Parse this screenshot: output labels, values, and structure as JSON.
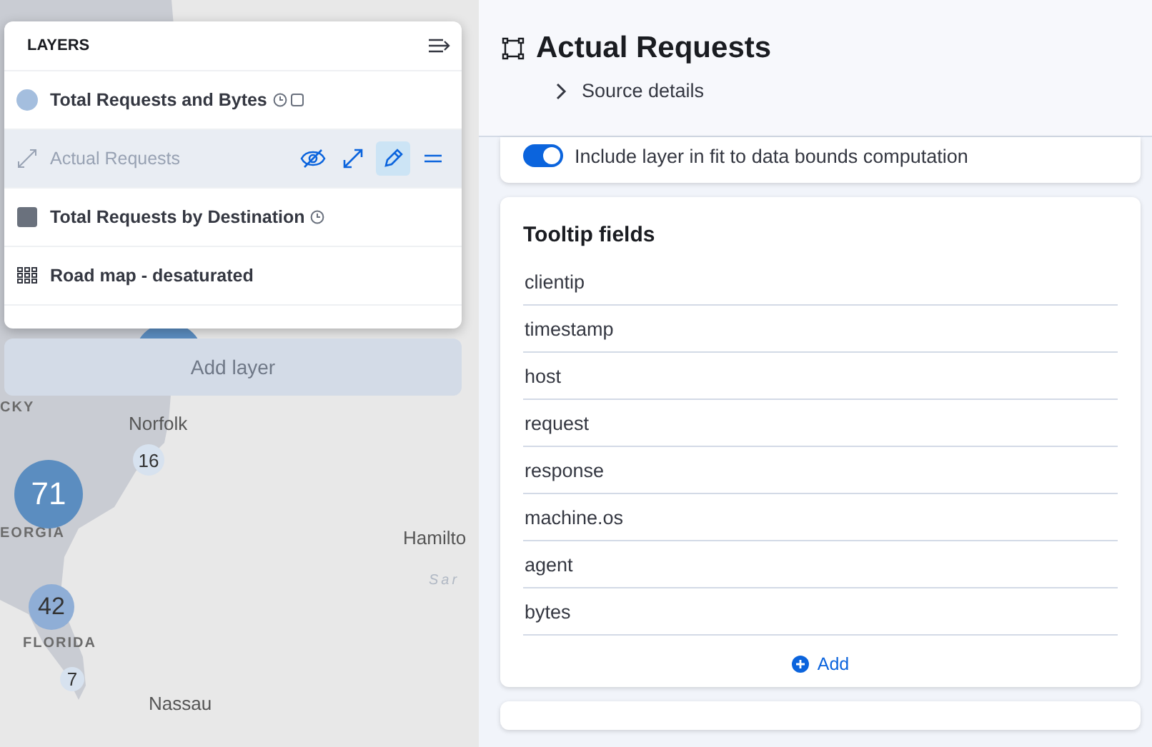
{
  "map": {
    "places": [
      {
        "name": "CKY",
        "kind": "region"
      },
      {
        "name": "Norfolk",
        "kind": "city"
      },
      {
        "name": "EORGIA",
        "kind": "region"
      },
      {
        "name": "Hamilto",
        "kind": "city"
      },
      {
        "name": "Sar",
        "kind": "sea"
      },
      {
        "name": "FLORIDA",
        "kind": "region"
      },
      {
        "name": "Nassau",
        "kind": "city"
      }
    ],
    "clusters": [
      {
        "count": "71",
        "kind": "large"
      },
      {
        "count": "42",
        "kind": "medium"
      },
      {
        "count": "16",
        "kind": "small"
      },
      {
        "count": "7",
        "kind": "small"
      }
    ]
  },
  "layers_panel": {
    "title": "LAYERS",
    "layers": [
      {
        "name": "Total Requests and Bytes",
        "kind": "circle",
        "color": "#a4bede",
        "selected": false,
        "visible": true,
        "time_filtered": true,
        "masked": true
      },
      {
        "name": "Actual Requests",
        "kind": "line",
        "selected": true,
        "visible": false,
        "time_filtered": false,
        "masked": false
      },
      {
        "name": "Total Requests by Destination",
        "kind": "square",
        "color": "#6a717d",
        "selected": false,
        "visible": true,
        "time_filtered": true,
        "masked": false
      },
      {
        "name": "Road map - desaturated",
        "kind": "tiles",
        "selected": false,
        "visible": true,
        "time_filtered": false,
        "masked": false
      }
    ],
    "add_button": {
      "label": "Add layer",
      "disabled": true
    }
  },
  "details": {
    "title": "Actual Requests",
    "source_toggle": {
      "label": "Source details",
      "expanded": false
    },
    "fit_bounds": {
      "label": "Include layer in fit to data bounds computation",
      "on": true
    },
    "tooltip_fields": {
      "title": "Tooltip fields",
      "fields": [
        "clientip",
        "timestamp",
        "host",
        "request",
        "response",
        "machine.os",
        "agent",
        "bytes"
      ],
      "add_label": "Add"
    }
  }
}
